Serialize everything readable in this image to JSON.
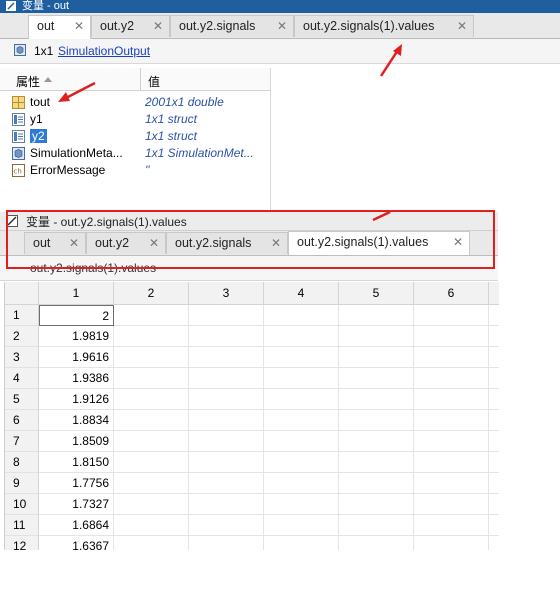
{
  "top_window": {
    "title": "变量 - out",
    "tabs": [
      "out",
      "out.y2",
      "out.y2.signals",
      "out.y2.signals(1).values"
    ],
    "close_glyph": "✕",
    "info": {
      "size": "1x1",
      "class_link": "SimulationOutput"
    },
    "columns": {
      "name": "属性",
      "value": "值"
    },
    "properties": [
      {
        "name": "tout",
        "value": "2001x1 double",
        "icon": "matrix-icon"
      },
      {
        "name": "y1",
        "value": "1x1 struct",
        "icon": "struct-icon"
      },
      {
        "name": "y2",
        "value": "1x1 struct",
        "icon": "struct-icon"
      },
      {
        "name": "SimulationMeta...",
        "value": "1x1 SimulationMet...",
        "icon": "object-icon"
      },
      {
        "name": "ErrorMessage",
        "value": "''",
        "icon": "char-icon"
      }
    ]
  },
  "bottom_window": {
    "title": "变量 - out.y2.signals(1).values",
    "tabs": [
      "out",
      "out.y2",
      "out.y2.signals",
      "out.y2.signals(1).values"
    ],
    "path": "out.y2.signals(1).values",
    "column_headers": [
      "1",
      "2",
      "3",
      "4",
      "5",
      "6"
    ],
    "rows": [
      {
        "index": "1",
        "value": "2"
      },
      {
        "index": "2",
        "value": "1.9819"
      },
      {
        "index": "3",
        "value": "1.9616"
      },
      {
        "index": "4",
        "value": "1.9386"
      },
      {
        "index": "5",
        "value": "1.9126"
      },
      {
        "index": "6",
        "value": "1.8834"
      },
      {
        "index": "7",
        "value": "1.8509"
      },
      {
        "index": "8",
        "value": "1.8150"
      },
      {
        "index": "9",
        "value": "1.7756"
      },
      {
        "index": "10",
        "value": "1.7327"
      },
      {
        "index": "11",
        "value": "1.6864"
      },
      {
        "index": "12",
        "value": "1.6367"
      }
    ]
  },
  "colors": {
    "annotation": "#e02020",
    "title_bar": "#1f5fa0",
    "link": "#1a3fbf",
    "value_text": "#2a52a8"
  }
}
